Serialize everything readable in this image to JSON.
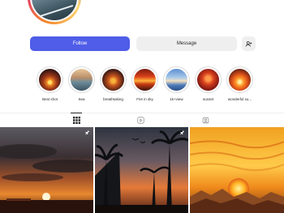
{
  "actions": {
    "follow_label": "Follow",
    "message_label": "Message",
    "add_user_icon": "add-user-icon"
  },
  "highlights": [
    {
      "label": "Best shot",
      "theme": "sunset-sea"
    },
    {
      "label": "Sea",
      "theme": "sea-boats"
    },
    {
      "label": "breathtaking",
      "theme": "dark-sunset"
    },
    {
      "label": "Fire in sky",
      "theme": "fire-sky"
    },
    {
      "label": "1k+view",
      "theme": "blue-sky"
    },
    {
      "label": "sunset",
      "theme": "red-sunset"
    },
    {
      "label": "wonderful su...",
      "theme": "orange-sunset"
    }
  ],
  "tabs": [
    {
      "name": "posts",
      "icon": "grid-icon",
      "active": true
    },
    {
      "name": "reels",
      "icon": "reels-icon",
      "active": false
    },
    {
      "name": "tagged",
      "icon": "tagged-icon",
      "active": false
    }
  ],
  "posts": [
    {
      "theme": "cloudy-sunset",
      "pinned": true
    },
    {
      "theme": "palm-sunset",
      "pinned": true
    },
    {
      "theme": "golden-sun",
      "pinned": false
    }
  ],
  "colors": {
    "accent": "#4f5de8",
    "secondary_button": "#efefef",
    "text": "#262626"
  }
}
